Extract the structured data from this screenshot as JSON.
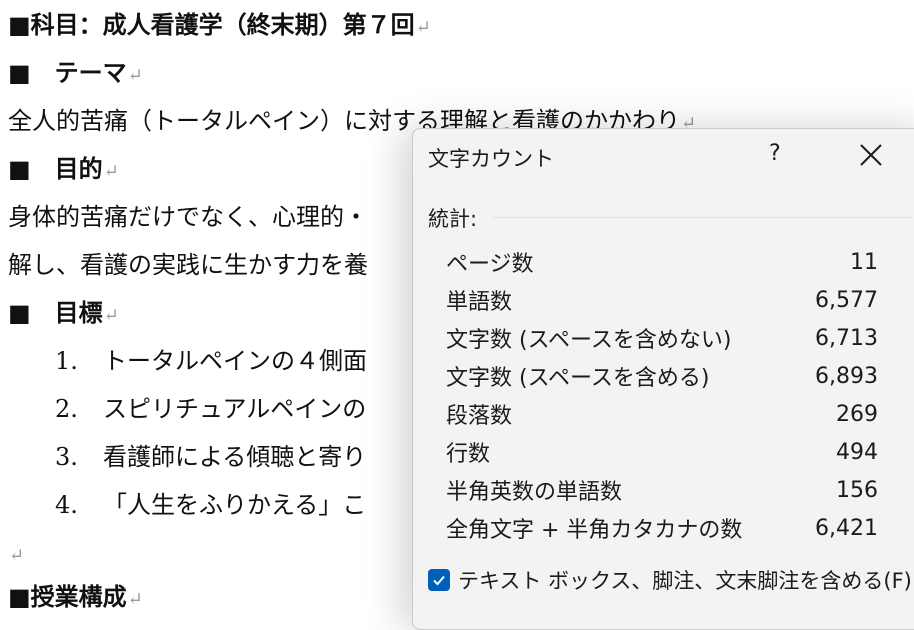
{
  "document": {
    "line1": "■科目：成人看護学（終末期）第７回",
    "line2": "■　テーマ",
    "line3": "全人的苦痛（トータルペイン）に対する理解と看護のかかわり",
    "line4": "■　目的",
    "line5": "身体的苦痛だけでなく、心理的・",
    "line6": "解し、看護の実践に生かす力を養",
    "line7": "■　目標",
    "list": [
      {
        "num": "1.",
        "text": "トータルペインの４側面"
      },
      {
        "num": "2.",
        "text": "スピリチュアルペインの"
      },
      {
        "num": "3.",
        "text": "看護師による傾聴と寄り"
      },
      {
        "num": "4.",
        "text": "「人生をふりかえる」こ"
      }
    ],
    "line_last": "■授業構成",
    "paragraph_mark": "↵"
  },
  "dialog": {
    "title": "文字カウント",
    "help": "?",
    "section": "統計:",
    "stats": [
      {
        "label": "ページ数",
        "value": "11"
      },
      {
        "label": "単語数",
        "value": "6,577"
      },
      {
        "label": "文字数 (スペースを含めない)",
        "value": "6,713"
      },
      {
        "label": "文字数 (スペースを含める)",
        "value": "6,893"
      },
      {
        "label": "段落数",
        "value": "269"
      },
      {
        "label": "行数",
        "value": "494"
      },
      {
        "label": "半角英数の単語数",
        "value": "156"
      },
      {
        "label": "全角文字 + 半角カタカナの数",
        "value": "6,421"
      }
    ],
    "checkbox_label": "テキスト ボックス、脚注、文末脚注を含める(F)",
    "checkbox_checked": true
  },
  "colors": {
    "accent": "#005fb8",
    "dialog_bg": "#f3f3f3"
  }
}
